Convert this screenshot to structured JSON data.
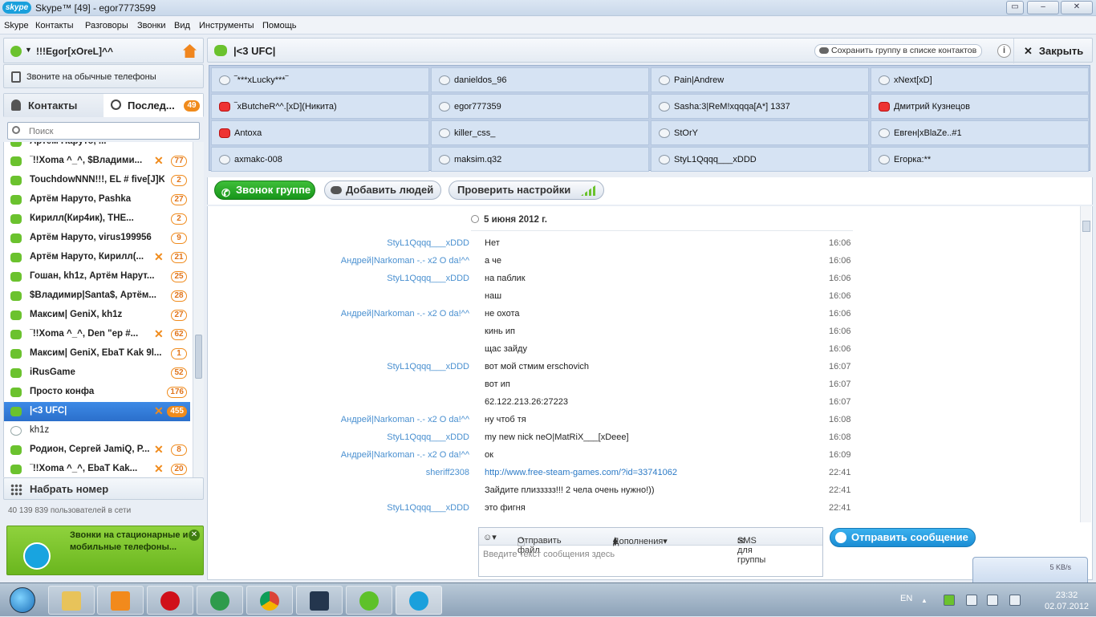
{
  "window": {
    "app_logo": "skype",
    "title": "Skype™ [49] - egor7773599",
    "controls": [
      "▭",
      "–",
      "✕"
    ]
  },
  "menu": [
    "Skype",
    "Контакты",
    "Разговоры",
    "Звонки",
    "Вид",
    "Инструменты",
    "Помощь"
  ],
  "profile": {
    "name": "!!!Egor[xOreL]^^",
    "status_color": "#6bc22e",
    "call_phones_label": "Звоните на обычные телефоны"
  },
  "tabs": {
    "contacts": "Контакты",
    "recent": "Послед...",
    "recent_badge": "49"
  },
  "search": {
    "placeholder": "Поиск"
  },
  "contacts": [
    {
      "name": "Артём Наруто, ...",
      "badge": "",
      "call": false,
      "status": "on"
    },
    {
      "name": "‾!!Xoma ^_^, $Владими...",
      "badge": "77",
      "call": true,
      "status": "on"
    },
    {
      "name": "TouchdowNNN!!!, EL # five[J]K...",
      "badge": "2",
      "call": false,
      "status": "on"
    },
    {
      "name": "Артём Наруто, Pashka",
      "badge": "27",
      "call": false,
      "status": "on"
    },
    {
      "name": "Кирилл(Кир4ик), ТНЕ...",
      "badge": "2",
      "call": false,
      "status": "on"
    },
    {
      "name": "Артём Наруто, virus199956",
      "badge": "9",
      "call": false,
      "status": "on"
    },
    {
      "name": "Артём Наруто, Кирилл(...",
      "badge": "21",
      "call": true,
      "status": "on"
    },
    {
      "name": "Гошан, kh1z, Артём Нарут...",
      "badge": "25",
      "call": false,
      "status": "on"
    },
    {
      "name": "$Владимир|Santa$, Артём...",
      "badge": "28",
      "call": false,
      "status": "on"
    },
    {
      "name": "Максим| GeniX, kh1z",
      "badge": "27",
      "call": false,
      "status": "on"
    },
    {
      "name": "‾!!Xoma ^_^, Den \"ep #...",
      "badge": "62",
      "call": true,
      "status": "on"
    },
    {
      "name": "Максим| GeniX, EbaT Kak 9l...",
      "badge": "1",
      "call": false,
      "status": "on"
    },
    {
      "name": "iRusGame",
      "badge": "52",
      "call": false,
      "status": "on"
    },
    {
      "name": "Просто конфа",
      "badge": "176",
      "call": false,
      "status": "on"
    },
    {
      "name": "|<3 UFC|",
      "badge": "455",
      "call": true,
      "status": "on",
      "selected": true
    },
    {
      "name": "kh1z",
      "badge": "",
      "call": false,
      "status": "off",
      "plain": true
    },
    {
      "name": "Родион, Сергей JamiQ, P...",
      "badge": "8",
      "call": true,
      "status": "on"
    },
    {
      "name": "‾!!Xoma ^_^, EbaT Kak...",
      "badge": "20",
      "call": true,
      "status": "on"
    }
  ],
  "dial_label": "Набрать номер",
  "online_count": "40 139 839 пользователей в сети",
  "promo": {
    "text": "Звонки на стационарные и мобильные телефоны..."
  },
  "group": {
    "title": "|<3 UFC|",
    "save_label": "Сохранить группу в списке контактов",
    "info_label": "i",
    "close_label": "Закрыть"
  },
  "members": [
    {
      "name": "‾***xLucky***‾",
      "busy": false
    },
    {
      "name": "danieldos_96",
      "busy": false
    },
    {
      "name": "Pain|Andrew",
      "busy": false
    },
    {
      "name": "xNext[xD]",
      "busy": false
    },
    {
      "name": "‾xButcheR^^.[xD](Никита)",
      "busy": true
    },
    {
      "name": "egor777359",
      "busy": false
    },
    {
      "name": "Sasha:3|ReM!xqqqa[A*] 1337",
      "busy": false
    },
    {
      "name": "Дмитрий Кузнецов",
      "busy": true
    },
    {
      "name": "Antoxa",
      "busy": true
    },
    {
      "name": "killer_css_",
      "busy": false
    },
    {
      "name": "StOrY",
      "busy": false
    },
    {
      "name": "Евген|xBlaZe..#1",
      "busy": false
    },
    {
      "name": "axmakc-008",
      "busy": false
    },
    {
      "name": "maksim.q32",
      "busy": false
    },
    {
      "name": "StyL1Qqqq___xDDD",
      "busy": false
    },
    {
      "name": "Егорка:**",
      "busy": false
    }
  ],
  "actions": {
    "call_group": "Звонок группе",
    "add_people": "Добавить людей",
    "check_settings": "Проверить настройки"
  },
  "chat": {
    "date": "5 июня 2012 г.",
    "messages": [
      {
        "sender": "StyL1Qqqq___xDDD",
        "text": "Нет",
        "time": "16:06"
      },
      {
        "sender": "Андрей|Narkoman -.- x2 O da!^^",
        "text": "а че",
        "time": "16:06"
      },
      {
        "sender": "StyL1Qqqq___xDDD",
        "text": "на паблик",
        "time": "16:06"
      },
      {
        "sender": "",
        "text": "наш",
        "time": "16:06"
      },
      {
        "sender": "Андрей|Narkoman -.- x2 O da!^^",
        "text": "не охота",
        "time": "16:06"
      },
      {
        "sender": "",
        "text": "кинь ип",
        "time": "16:06"
      },
      {
        "sender": "",
        "text": "щас зайду",
        "time": "16:06"
      },
      {
        "sender": "StyL1Qqqq___xDDD",
        "text": "вот мой стмим erschovich",
        "time": "16:07"
      },
      {
        "sender": "",
        "text": "вот ип",
        "time": "16:07"
      },
      {
        "sender": "",
        "text": "62.122.213.26:27223",
        "time": "16:07"
      },
      {
        "sender": "Андрей|Narkoman -.- x2 O da!^^",
        "text": "ну чтоб тя",
        "time": "16:08"
      },
      {
        "sender": "StyL1Qqqq___xDDD",
        "text": "my new nick neO|MatRiX___[xDeee]",
        "time": "16:08"
      },
      {
        "sender": "Андрей|Narkoman -.- x2 O da!^^",
        "text": "ок",
        "time": "16:09"
      },
      {
        "sender": "sheriff2308",
        "text": "http://www.free-steam-games.com/?id=33741062",
        "time": "22:41",
        "link": true
      },
      {
        "sender": "",
        "text": "Зайдите плиззззз!!!   2 чела очень нужно!))",
        "time": "22:41"
      },
      {
        "sender": "StyL1Qqqq___xDDD",
        "text": "это фигня",
        "time": "22:41"
      }
    ]
  },
  "compose": {
    "emoji": "☺▾",
    "send_file": "Отправить файл",
    "extras": "Дополнения▾",
    "sms": "SMS для группы",
    "placeholder": "Введите текст сообщения здесь",
    "send_button": "Отправить сообщение"
  },
  "net_popup": {
    "speed": "5 KB/s"
  },
  "tray": {
    "lang": "EN",
    "time": "23:32",
    "date": "02.07.2012"
  }
}
